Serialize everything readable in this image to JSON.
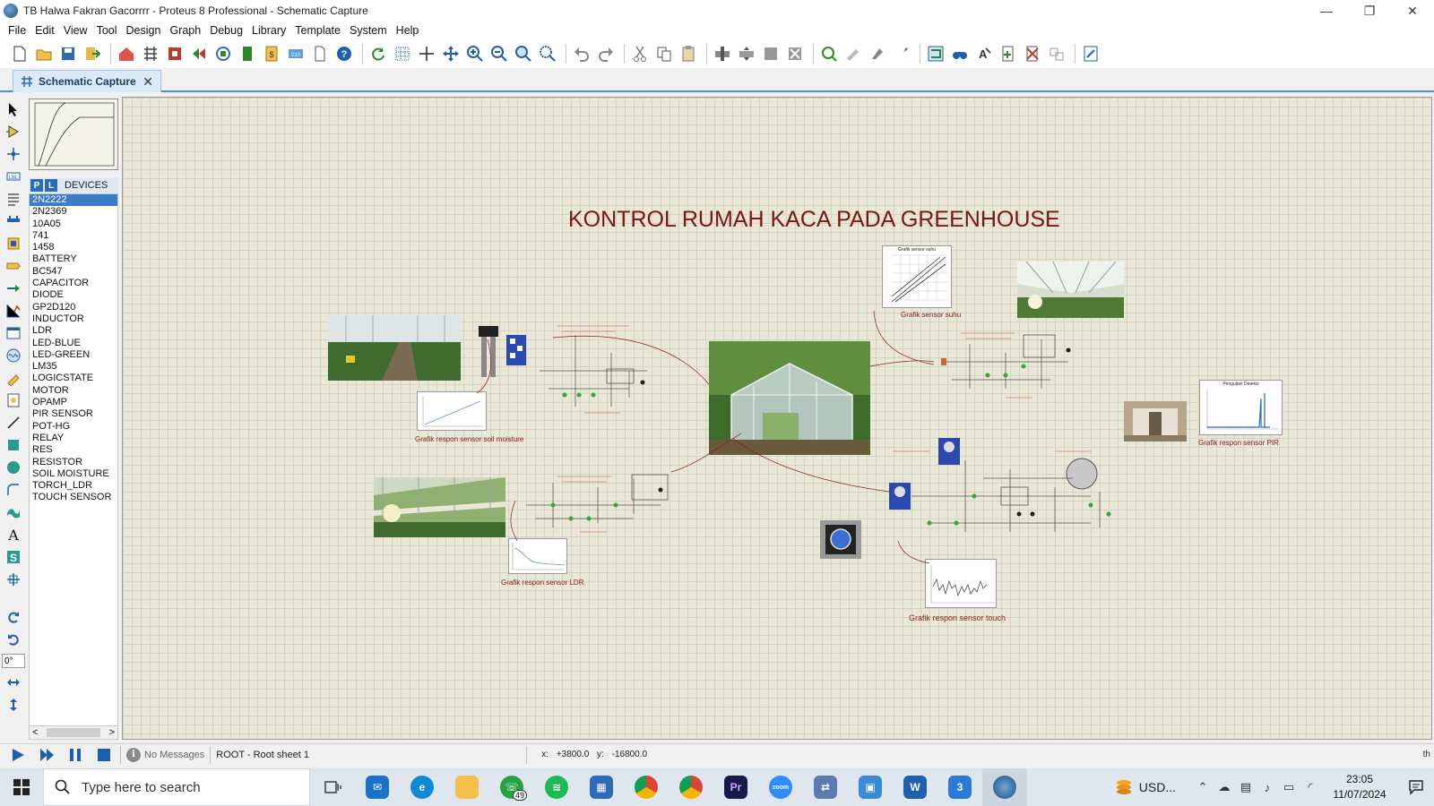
{
  "window": {
    "title": "TB Halwa Fakran Gacorrrr - Proteus 8 Professional - Schematic Capture",
    "minimize": "—",
    "restore": "❐",
    "close": "✕"
  },
  "menu": [
    "File",
    "Edit",
    "View",
    "Tool",
    "Design",
    "Graph",
    "Debug",
    "Library",
    "Template",
    "System",
    "Help"
  ],
  "tab": {
    "label": "Schematic Capture",
    "close": "✕"
  },
  "device_panel": {
    "p_button": "P",
    "l_button": "L",
    "title": "DEVICES",
    "selected": "2N2222",
    "items": [
      "2N2222",
      "2N2369",
      "10A05",
      "741",
      "1458",
      "BATTERY",
      "BC547",
      "CAPACITOR",
      "DIODE",
      "GP2D120",
      "INDUCTOR",
      "LDR",
      "LED-BLUE",
      "LED-GREEN",
      "LM35",
      "LOGICSTATE",
      "MOTOR",
      "OPAMP",
      "PIR SENSOR",
      "POT-HG",
      "RELAY",
      "RES",
      "RESISTOR",
      "SOIL MOISTURE",
      "TORCH_LDR",
      "TOUCH SENSOR"
    ],
    "scroll_left": "<",
    "scroll_right": ">"
  },
  "rotation": "0°",
  "canvas": {
    "title": "KONTROL RUMAH KACA PADA GREENHOUSE",
    "captions": {
      "soil": "Grafik respon sensor soil moisture",
      "ldr": "Grafik respon sensor LDR",
      "suhu": "Grafik sensor suhu",
      "pir": "Grafik respon sensor PIR",
      "touch": "Grafik respon sensor touch"
    },
    "graph_titles": {
      "suhu": "Grafik sensor suhu",
      "pir": "Pengujian Deteksi"
    }
  },
  "status": {
    "messages": "No Messages",
    "sheet": "ROOT - Root sheet 1",
    "x_label": "x:",
    "x_value": "+3800.0",
    "y_label": "y:",
    "y_value": "-16800.0",
    "right": "th"
  },
  "taskbar": {
    "search_placeholder": "Type here to search",
    "whatsapp_badge": "49",
    "tray_app": "USD...",
    "time": "23:05",
    "date": "11/07/2024"
  },
  "colors": {
    "accent": "#2b6cb7",
    "title_red": "#7f1414",
    "caption_red": "#8b1a1a",
    "canvas_bg": "#e9e7d8",
    "selected": "#3d7cc9"
  }
}
